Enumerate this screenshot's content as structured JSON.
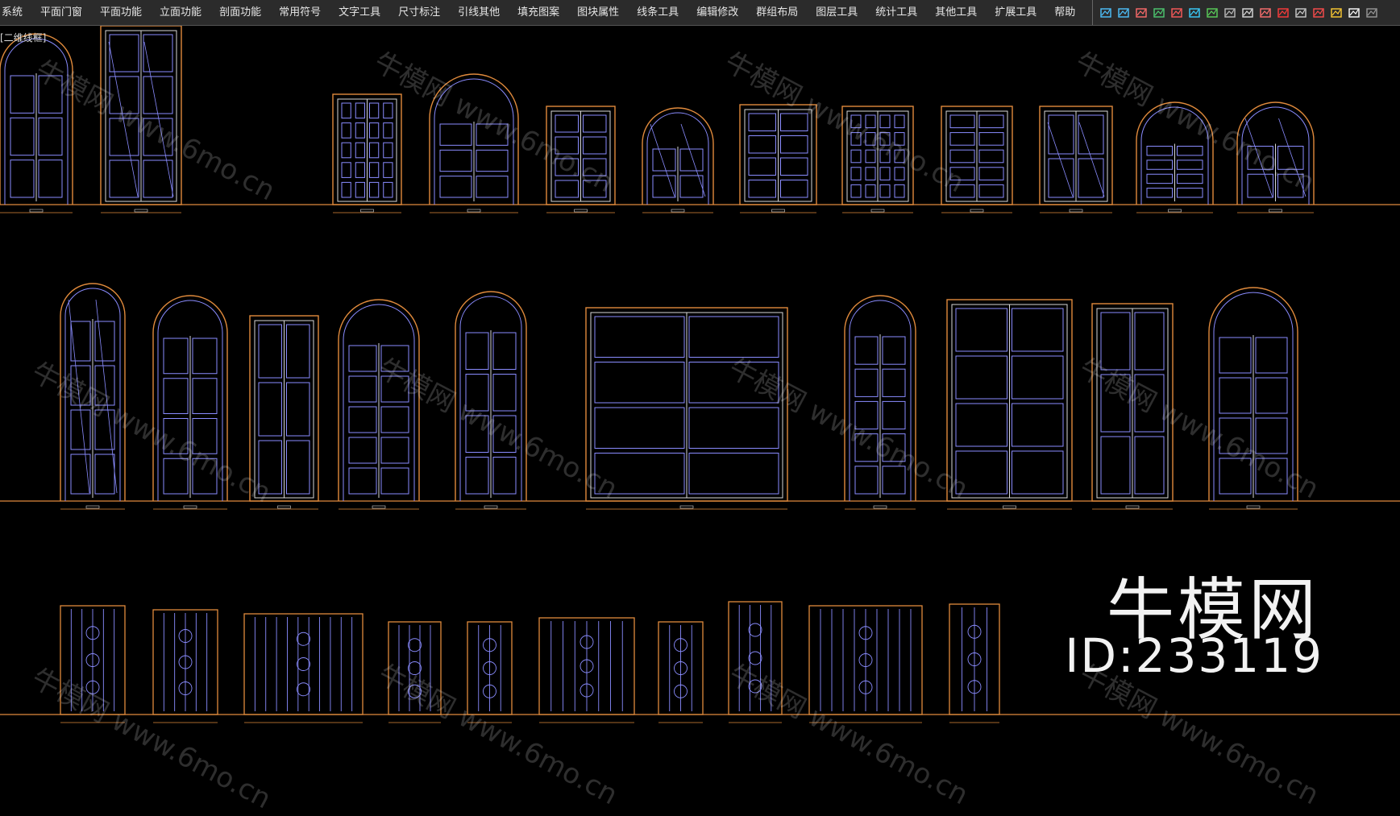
{
  "menu": {
    "items": [
      "系统",
      "平面门窗",
      "平面功能",
      "立面功能",
      "剖面功能",
      "常用符号",
      "文字工具",
      "尺寸标注",
      "引线其他",
      "填充图案",
      "图块属性",
      "线条工具",
      "编辑修改",
      "群组布局",
      "图层工具",
      "统计工具",
      "其他工具",
      "扩展工具",
      "帮助"
    ]
  },
  "view_label": "[二维线框]",
  "watermark": {
    "text": "牛模网 www.6mo.cn"
  },
  "brand": {
    "name": "牛模网",
    "id_text": "ID:233119"
  },
  "colors": {
    "background": "#000000",
    "frame": "#e08a3c",
    "inner": "#8a8cff",
    "ground": "#e08a3c",
    "white_line": "#d8d8d8"
  },
  "icons": [
    "wave-icon",
    "wave2-icon",
    "bars-icon",
    "zigzag-icon",
    "person-icon",
    "stack-icon",
    "ladder-icon",
    "ruler-icon",
    "grid-icon",
    "flag-icon",
    "tree-icon",
    "gear-icon",
    "circle-icon",
    "pen-icon",
    "text-icon",
    "lines-icon"
  ]
}
